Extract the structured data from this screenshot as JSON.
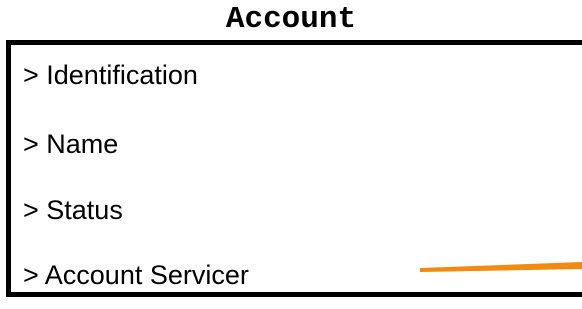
{
  "title": "Account",
  "items": [
    "> Identification",
    "> Name",
    "> Status",
    "> Account Servicer"
  ],
  "colors": {
    "border": "#000000",
    "connector": "#f08a10"
  }
}
